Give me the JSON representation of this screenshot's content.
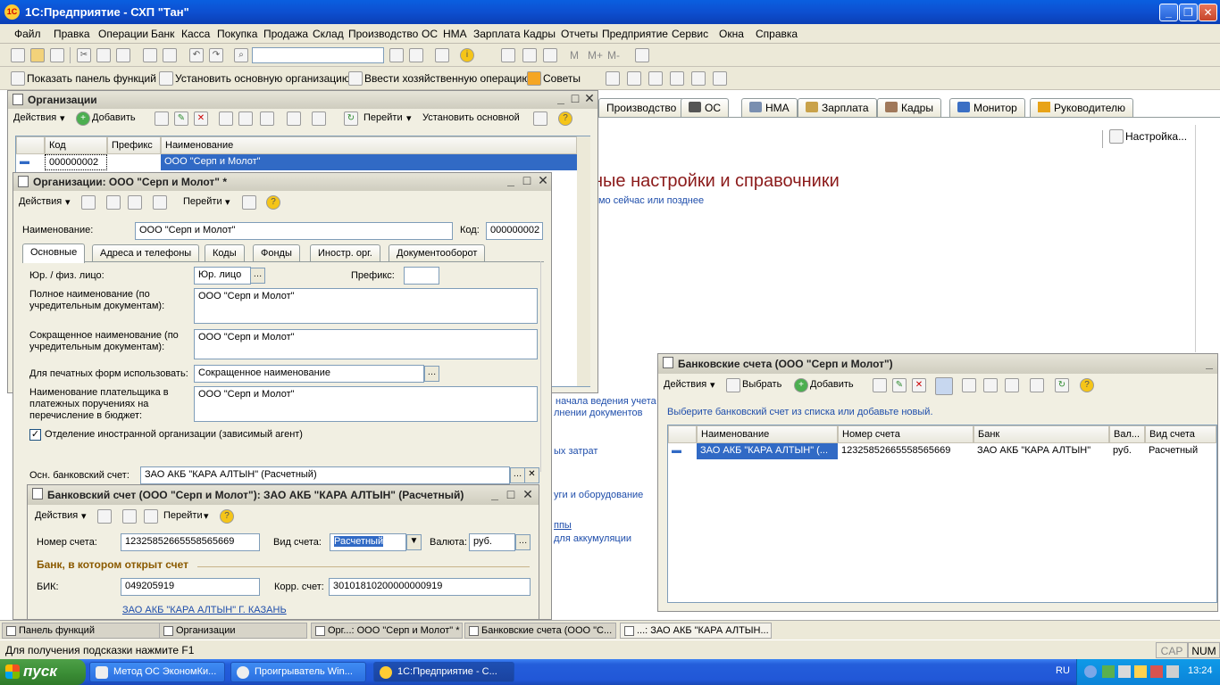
{
  "app": {
    "title": "1С:Предприятие - СХП \"Тан\"",
    "icon_text": "1С"
  },
  "menu": [
    "Файл",
    "Правка",
    "Операции",
    "Банк",
    "Касса",
    "Покупка",
    "Продажа",
    "Склад",
    "Производство",
    "ОС",
    "НМА",
    "Зарплата",
    "Кадры",
    "Отчеты",
    "Предприятие",
    "Сервис",
    "Окна",
    "Справка"
  ],
  "toolbar2": {
    "show_panel": "Показать панель функций",
    "set_org": "Установить основную организацию",
    "enter_op": "Ввести хозяйственную операцию",
    "tips": "Советы",
    "m_labels": [
      "M",
      "M+",
      "M-"
    ]
  },
  "main_tabs": [
    "Производство",
    "ОС",
    "НМА",
    "Зарплата",
    "Кадры",
    "Монитор",
    "Руководителю"
  ],
  "main": {
    "settings_link": "Настройка...",
    "heading": "ные настройки и справочники",
    "subheading": "ямо сейчас или позднее",
    "links": [
      "начала ведения учета",
      "лнении документов",
      "ых затрат",
      "уги и оборудование",
      "ппы",
      "для аккумуляции"
    ]
  },
  "org_list": {
    "title": "Организации",
    "toolbar": {
      "actions": "Действия",
      "add": "Добавить",
      "goto": "Перейти",
      "set_main": "Установить основной"
    },
    "columns": [
      "Код",
      "Префикс",
      "Наименование"
    ],
    "rows": [
      {
        "code": "000000002",
        "prefix": "",
        "name": "ООО \"Серп и Молот\""
      }
    ]
  },
  "org_form": {
    "title": "Организации: ООО \"Серп и Молот\" *",
    "toolbar": {
      "actions": "Действия",
      "goto": "Перейти"
    },
    "name_label": "Наименование:",
    "name_value": "ООО \"Серп и Молот\"",
    "code_label": "Код:",
    "code_value": "000000002",
    "tabs": [
      "Основные",
      "Адреса и телефоны",
      "Коды",
      "Фонды",
      "Иностр. орг.",
      "Документооборот"
    ],
    "legal_label": "Юр. / физ. лицо:",
    "legal_value": "Юр. лицо",
    "prefix_label": "Префикс:",
    "full_name_label": "Полное наименование (по учредительным документам):",
    "full_name_value": "ООО \"Серп и Молот\"",
    "short_name_label": "Сокращенное наименование (по учредительным документам):",
    "short_name_value": "ООО \"Серп и Молот\"",
    "print_label": "Для печатных форм использовать:",
    "print_value": "Сокращенное наименование",
    "payer_label": "Наименование плательщика в платежных поручениях на перечисление в бюджет:",
    "payer_value": "ООО \"Серп и Молот\"",
    "foreign_checkbox": "Отделение иностранной организации (зависимый агент)",
    "foreign_checked": true,
    "bank_label": "Осн. банковский счет:",
    "bank_value": "ЗАО АКБ \"КАРА АЛТЫН\" (Расчетный)"
  },
  "bank_form": {
    "title": "Банковский счет (ООО \"Серп и Молот\"): ЗАО АКБ \"КАРА АЛТЫН\" (Расчетный)",
    "toolbar": {
      "actions": "Действия",
      "goto": "Перейти"
    },
    "acct_label": "Номер счета:",
    "acct_value": "12325852665558565669",
    "type_label": "Вид счета:",
    "type_value": "Расчетный",
    "curr_label": "Валюта:",
    "curr_value": "руб.",
    "section": "Банк, в котором открыт счет",
    "bik_label": "БИК:",
    "bik_value": "049205919",
    "corr_label": "Корр. счет:",
    "corr_value": "30101810200000000919",
    "bank_link": "ЗАО АКБ \"КАРА АЛТЫН\" Г. КАЗАНЬ"
  },
  "bank_list": {
    "title": "Банковские счета (ООО \"Серп и Молот\")",
    "toolbar": {
      "actions": "Действия",
      "choose": "Выбрать",
      "add": "Добавить"
    },
    "hint": "Выберите банковский счет из списка или добавьте новый.",
    "columns": [
      "Наименование",
      "Номер счета",
      "Банк",
      "Вал...",
      "Вид счета"
    ],
    "rows": [
      {
        "name": "ЗАО АКБ \"КАРА АЛТЫН\" (...",
        "number": "12325852665558565669",
        "bank": "ЗАО АКБ \"КАРА АЛТЫН\"",
        "currency": "руб.",
        "type": "Расчетный"
      }
    ]
  },
  "window_bar": [
    "Панель функций",
    "Организации",
    "Орг...: ООО \"Серп и Молот\" *",
    "Банковские счета (ООО \"С...",
    "...: ЗАО АКБ \"КАРА АЛТЫН..."
  ],
  "status": {
    "hint": "Для получения подсказки нажмите F1",
    "cap": "CAP",
    "num": "NUM"
  },
  "taskbar": {
    "start": "пуск",
    "tasks": [
      "Метод ОС ЭкономКи...",
      "Проигрыватель Win...",
      "1С:Предприятие - С..."
    ],
    "lang": "RU",
    "time": "13:24"
  },
  "colors": {
    "xp_blue": "#0a5fe0",
    "accent_dark_red": "#8b1a1a",
    "selection": "#316ac5",
    "section_brown": "#8b5a00"
  }
}
